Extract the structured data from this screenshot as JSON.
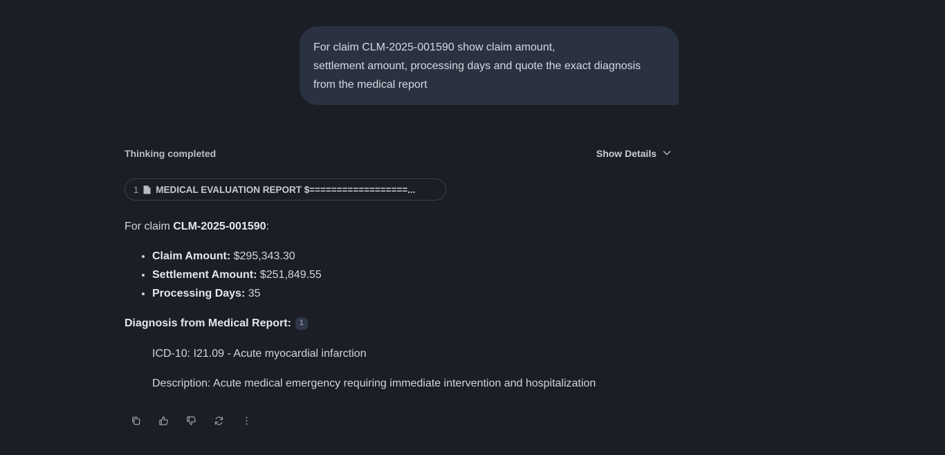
{
  "user_message": {
    "lines": [
      "For claim CLM-2025-001590 show claim amount,",
      "settlement amount, processing days and quote the exact diagnosis",
      "from the medical report"
    ]
  },
  "thinking": {
    "status": "Thinking completed",
    "details_label": "Show Details"
  },
  "source": {
    "number": "1",
    "icon": "document-icon",
    "title": "MEDICAL EVALUATION REPORT $==================..."
  },
  "answer": {
    "intro_prefix": "For claim ",
    "claim_id": "CLM-2025-001590",
    "intro_suffix": ":",
    "facts": [
      {
        "label": "Claim Amount:",
        "value": " $295,343.30"
      },
      {
        "label": "Settlement Amount:",
        "value": " $251,849.55"
      },
      {
        "label": "Processing Days:",
        "value": " 35"
      }
    ],
    "diagnosis_heading": "Diagnosis from Medical Report:",
    "citation": "1",
    "quotes": [
      "ICD-10: I21.09 - Acute myocardial infarction",
      "Description: Acute medical emergency requiring immediate intervention and hospitalization"
    ]
  },
  "actions": [
    {
      "name": "copy-icon"
    },
    {
      "name": "thumbs-up-icon"
    },
    {
      "name": "thumbs-down-icon"
    },
    {
      "name": "regenerate-icon"
    },
    {
      "name": "more-options-icon"
    }
  ],
  "colors": {
    "background": "#1b1e25",
    "user_bubble": "#2a3141",
    "citation_badge": "#30384a"
  }
}
